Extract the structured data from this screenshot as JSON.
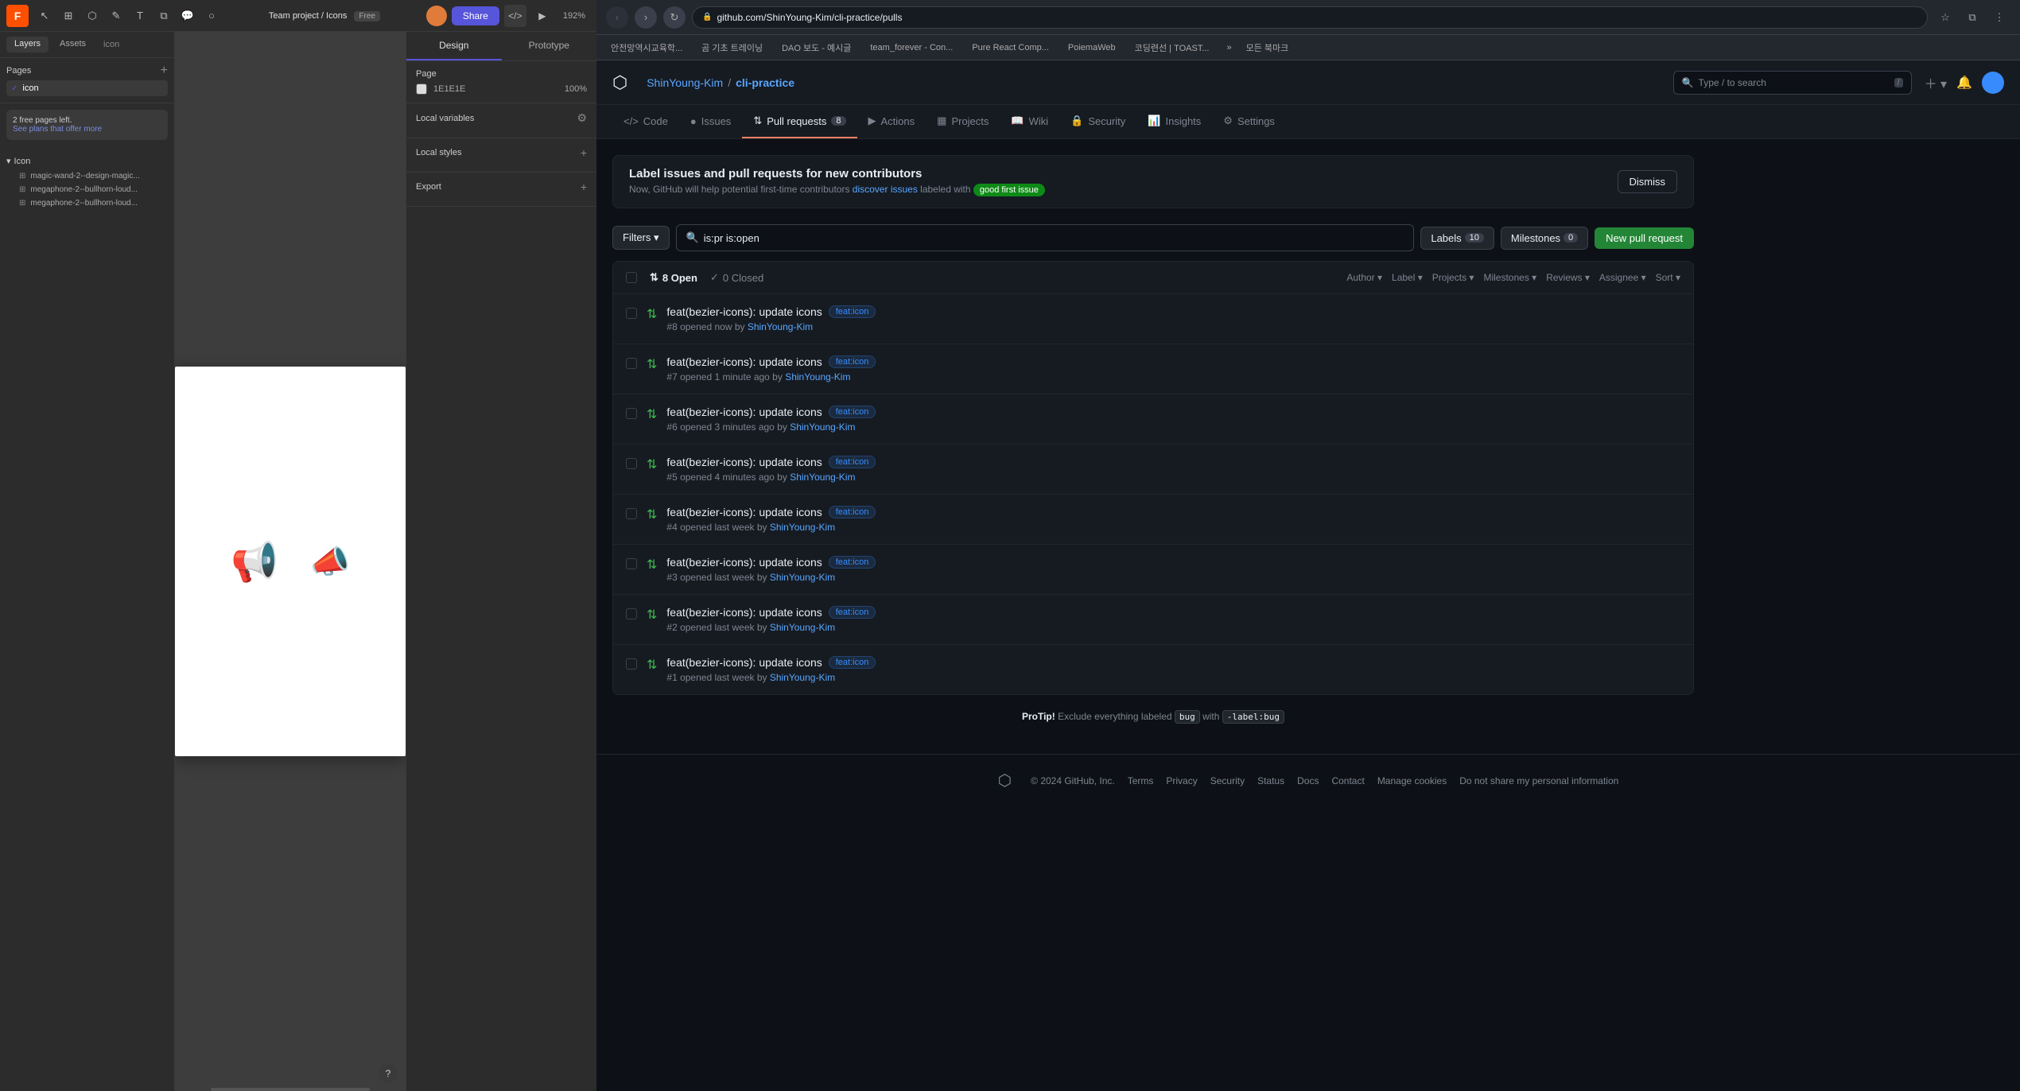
{
  "figma": {
    "toolbar": {
      "logo": "F",
      "team_project": "Team project",
      "separator1": "/",
      "icons_label": "Icons",
      "free_badge": "Free",
      "share_label": "Share",
      "zoom": "192%"
    },
    "sidebar_tabs": [
      {
        "label": "Layers",
        "active": true
      },
      {
        "label": "Assets",
        "active": false
      },
      {
        "label": "icon",
        "active": false
      }
    ],
    "pages": {
      "title": "Pages",
      "items": [
        {
          "label": "icon",
          "active": true
        }
      ]
    },
    "promo": {
      "line1": "2 free pages left.",
      "link_text": "See plans that offer more"
    },
    "layers": {
      "group_label": "Icon",
      "items": [
        {
          "label": "magic-wand-2--design-magic...",
          "icon": "⊞"
        },
        {
          "label": "megaphone-2--bullhorn-loud...",
          "icon": "⊞"
        },
        {
          "label": "megaphone-2--bullhorn-loud...",
          "icon": "⊞"
        }
      ]
    },
    "design_tabs": [
      {
        "label": "Design",
        "active": true
      },
      {
        "label": "Prototype",
        "active": false
      }
    ],
    "design_sections": {
      "page": {
        "title": "Page",
        "color_label": "1E1E1E",
        "value": "100%"
      },
      "local_variables": "Local variables",
      "local_styles": "Local styles",
      "export": "Export"
    },
    "help_label": "?"
  },
  "browser": {
    "url": "github.com/ShinYoung-Kim/cli-practice/pulls",
    "bookmarks": [
      "안전망역시교육학...",
      "곰 기초 트레이닝",
      "DAO 보도 - 예시글",
      "team_forever - Con...",
      "Pure React Comp...",
      "PoiemaWeb",
      "코딩련선 | TOAST...",
      "모든 북마크"
    ]
  },
  "github": {
    "nav": {
      "owner": "ShinYoung-Kim",
      "separator": "/",
      "repo": "cli-practice",
      "search_placeholder": "Type / to search"
    },
    "tabs": [
      {
        "label": "Code",
        "icon": "⌥",
        "active": false
      },
      {
        "label": "Issues",
        "icon": "●",
        "count": "",
        "active": false
      },
      {
        "label": "Pull requests",
        "icon": "⇅",
        "count": "8",
        "active": true
      },
      {
        "label": "Actions",
        "icon": "▶",
        "active": false
      },
      {
        "label": "Projects",
        "icon": "▦",
        "active": false
      },
      {
        "label": "Wiki",
        "icon": "📖",
        "active": false
      },
      {
        "label": "Security",
        "icon": "🔒",
        "active": false
      },
      {
        "label": "Insights",
        "icon": "📊",
        "active": false
      },
      {
        "label": "Settings",
        "icon": "⚙",
        "active": false
      }
    ],
    "label_banner": {
      "title": "Label issues and pull requests for new contributors",
      "desc_prefix": "Now, GitHub will help potential first-time contributors",
      "desc_link": "discover issues",
      "desc_suffix": "labeled with",
      "badge": "good first issue",
      "dismiss_label": "Dismiss"
    },
    "filters": {
      "filter_label": "Filters ▾",
      "search_value": "is:pr is:open",
      "labels_label": "Labels",
      "labels_count": "10",
      "milestones_label": "Milestones",
      "milestones_count": "0",
      "new_pr_label": "New pull request"
    },
    "pr_list": {
      "open_count": "8 Open",
      "closed_count": "0 Closed",
      "sort_options": [
        {
          "label": "Author ▾"
        },
        {
          "label": "Label ▾"
        },
        {
          "label": "Projects ▾"
        },
        {
          "label": "Milestones ▾"
        },
        {
          "label": "Reviews ▾"
        },
        {
          "label": "Assignee ▾"
        },
        {
          "label": "Sort ▾"
        }
      ],
      "items": [
        {
          "number": "#8",
          "title": "feat(bezier-icons): update icons",
          "tag": "feat:icon",
          "meta": "opened now by ShinYoung-Kim"
        },
        {
          "number": "#7",
          "title": "feat(bezier-icons): update icons",
          "tag": "feat:icon",
          "meta": "opened 1 minute ago by ShinYoung-Kim"
        },
        {
          "number": "#6",
          "title": "feat(bezier-icons): update icons",
          "tag": "feat:icon",
          "meta": "opened 3 minutes ago by ShinYoung-Kim"
        },
        {
          "number": "#5",
          "title": "feat(bezier-icons): update icons",
          "tag": "feat:icon",
          "meta": "opened 4 minutes ago by ShinYoung-Kim"
        },
        {
          "number": "#4",
          "title": "feat(bezier-icons): update icons",
          "tag": "feat:icon",
          "meta": "opened last week by ShinYoung-Kim"
        },
        {
          "number": "#3",
          "title": "feat(bezier-icons): update icons",
          "tag": "feat:icon",
          "meta": "opened last week by ShinYoung-Kim"
        },
        {
          "number": "#2",
          "title": "feat(bezier-icons): update icons",
          "tag": "feat:icon",
          "meta": "opened last week by ShinYoung-Kim"
        },
        {
          "number": "#1",
          "title": "feat(bezier-icons): update icons",
          "tag": "feat:icon",
          "meta": "opened last week by ShinYoung-Kim"
        }
      ]
    },
    "protip": {
      "label": "ProTip!",
      "desc_prefix": "Exclude everything labeled",
      "code1": "bug",
      "desc_mid": "with",
      "code2": "-label:bug",
      "link": null
    },
    "footer": {
      "copyright": "© 2024 GitHub, Inc.",
      "links": [
        "Terms",
        "Privacy",
        "Security",
        "Status",
        "Docs",
        "Contact",
        "Manage cookies",
        "Do not share my personal information"
      ]
    }
  }
}
